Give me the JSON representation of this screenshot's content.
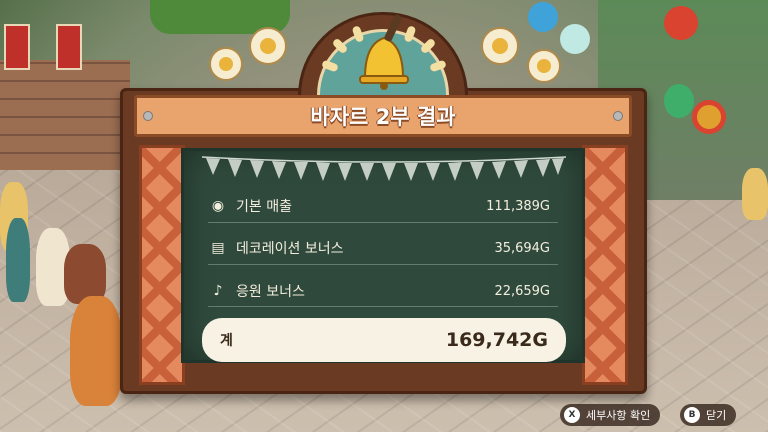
{
  "title": "바자르 2부 결과",
  "rows": [
    {
      "icon": "money-bag-icon",
      "glyph": "◉",
      "label": "기본 매출",
      "value": "111,389G"
    },
    {
      "icon": "decoration-icon",
      "glyph": "▤",
      "label": "데코레이션 보너스",
      "value": "35,694G"
    },
    {
      "icon": "music-note-icon",
      "glyph": "♪",
      "label": "응원 보너스",
      "value": "22,659G"
    }
  ],
  "total": {
    "label": "계",
    "value": "169,742G"
  },
  "prompts": {
    "details": {
      "key": "X",
      "label": "세부사항 확인"
    },
    "close": {
      "key": "B",
      "label": "닫기"
    }
  },
  "colors": {
    "chalkboard": "#2f4a3c",
    "title_board": "#e9a36d",
    "frame": "#6a3b22",
    "total_bg": "#f7f2e3"
  }
}
